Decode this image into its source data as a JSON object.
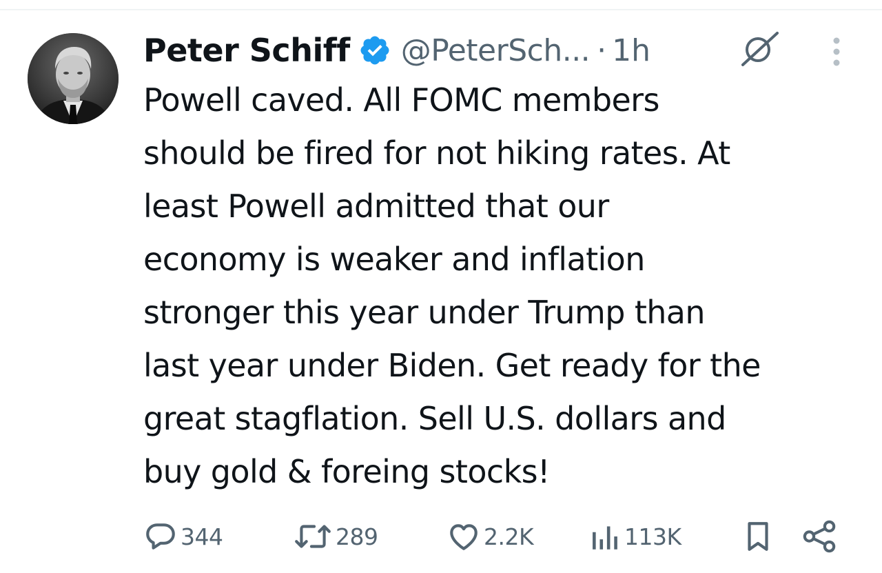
{
  "author": {
    "display_name": "Peter Schiff",
    "handle": "@PeterSch...",
    "separator": "·",
    "time": "1h"
  },
  "tweet": {
    "lines": [
      "Powell caved. All FOMC members",
      "should be fired for not hiking rates. At",
      "least Powell admitted that our",
      "economy is weaker and inflation",
      "stronger this year under Trump than",
      "last year under Biden. Get ready for the",
      "great stagflation. Sell U.S. dollars and",
      "buy gold & foreing stocks!"
    ]
  },
  "actions": {
    "replies": "344",
    "reposts": "289",
    "likes": "2.2K",
    "views": "113K"
  },
  "icons": {
    "verified": "verified-badge-icon",
    "grok": "grok-icon",
    "more": "more-icon",
    "reply": "reply-icon",
    "repost": "repost-icon",
    "like": "like-icon",
    "views": "views-icon",
    "bookmark": "bookmark-icon",
    "share": "share-icon"
  },
  "colors": {
    "text": "#0f1419",
    "muted": "#536471",
    "verified": "#1d9bf0"
  }
}
